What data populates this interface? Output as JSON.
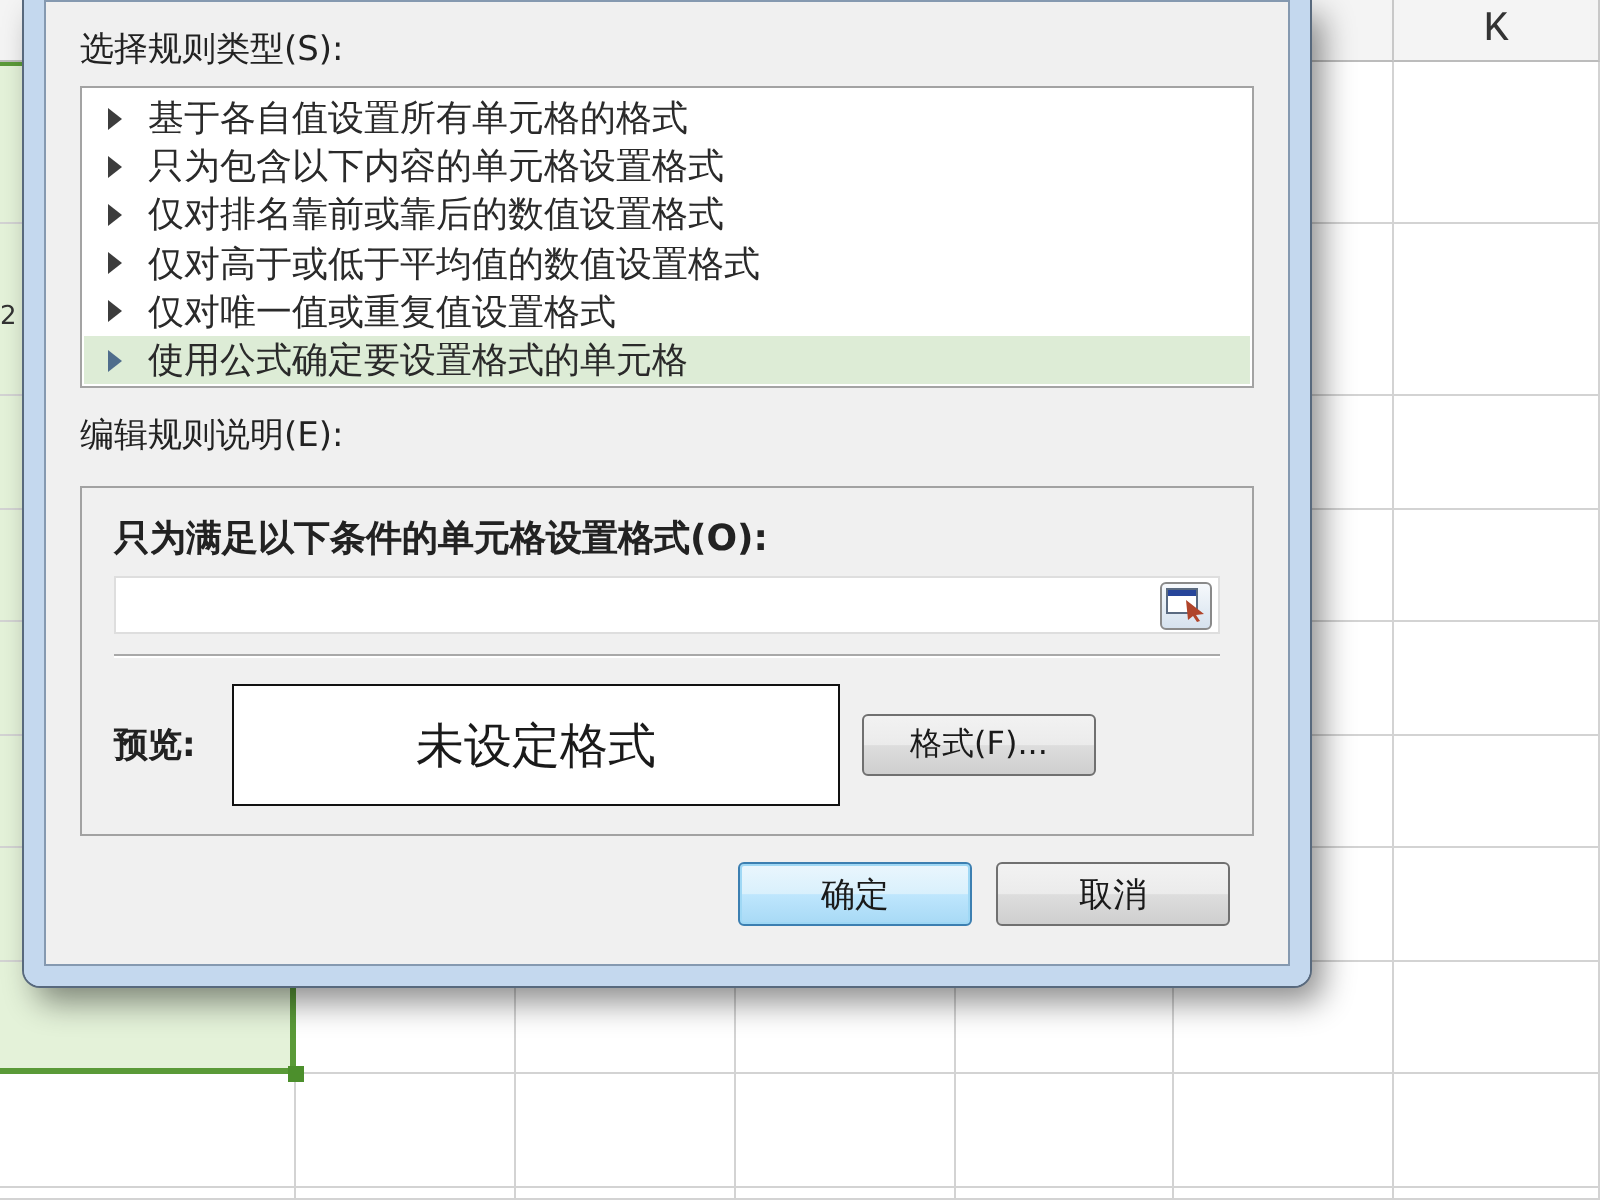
{
  "sheet": {
    "column_header": "K",
    "left_column": {
      "selected": true,
      "cell_text": "2"
    }
  },
  "dialog": {
    "rule_type_label": "选择规则类型(S):",
    "rule_types": [
      {
        "label": "基于各自值设置所有单元格的格式",
        "selected": false
      },
      {
        "label": "只为包含以下内容的单元格设置格式",
        "selected": false
      },
      {
        "label": "仅对排名靠前或靠后的数值设置格式",
        "selected": false
      },
      {
        "label": "仅对高于或低于平均值的数值设置格式",
        "selected": false
      },
      {
        "label": "仅对唯一值或重复值设置格式",
        "selected": false
      },
      {
        "label": "使用公式确定要设置格式的单元格",
        "selected": true
      }
    ],
    "description_label": "编辑规则说明(E):",
    "condition_label": "只为满足以下条件的单元格设置格式(O):",
    "preview_label": "预览:",
    "preview_text": "未设定格式",
    "format_button": "格式(F)...",
    "buttons": [
      {
        "label": "确定",
        "default": true
      },
      {
        "label": "取消",
        "default": false
      }
    ]
  }
}
